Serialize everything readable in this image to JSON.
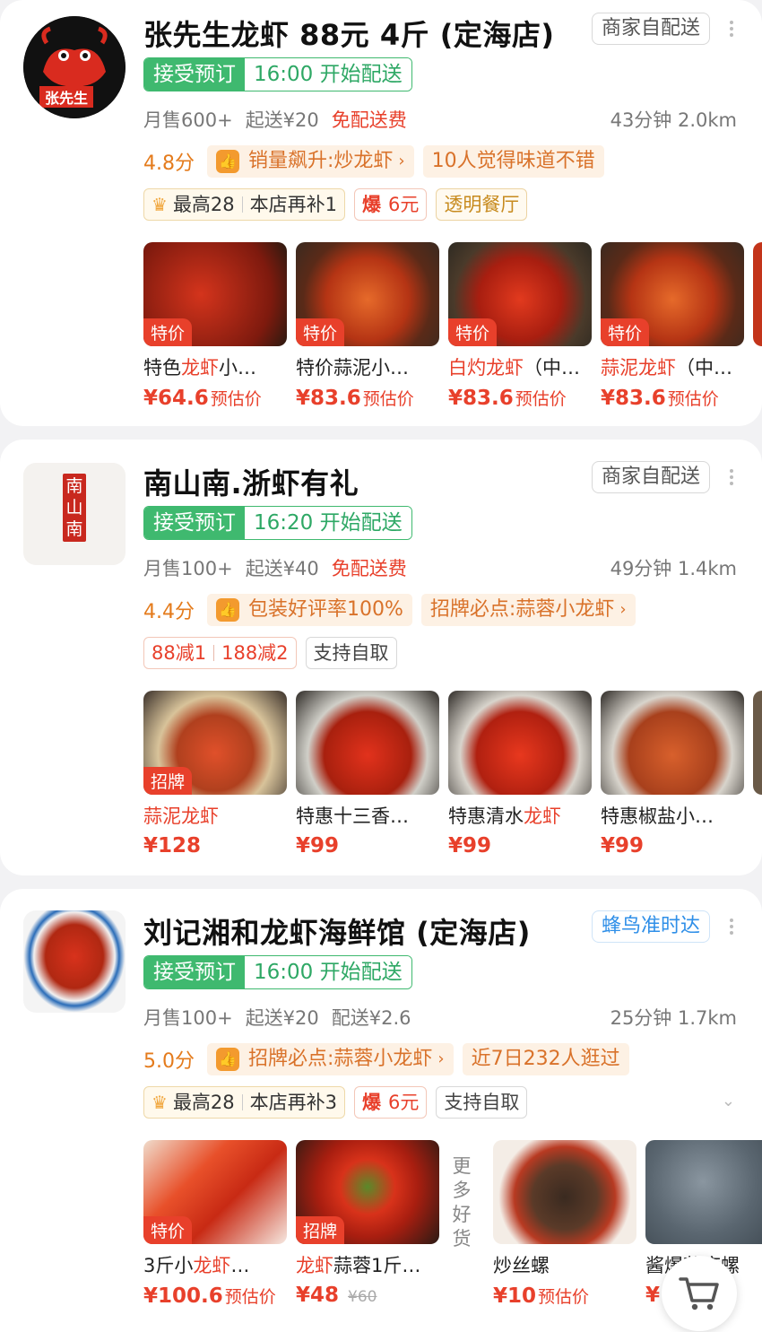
{
  "stores": [
    {
      "name": "张先生龙虾 88元 4斤 (定海店)",
      "delivery_tag": "商家自配送",
      "logo_text": "张先生",
      "booking": {
        "status": "接受预订",
        "start": "16:00 开始配送"
      },
      "monthly_sales": "月售600+",
      "min_order": "起送¥20",
      "delivery_fee": "免配送费",
      "eta": "43分钟 2.0km",
      "score": "4.8分",
      "highlight": "销量飙升:炒龙虾",
      "extra_tag": "10人觉得味道不错",
      "promos": {
        "max": "最高28",
        "subsidy": "本店再补1",
        "hot_label": "爆",
        "hot_value": "6元",
        "tag": "透明餐厅"
      },
      "items": [
        {
          "badge": "特价",
          "name_pre": "特色",
          "name_hl": "龙虾",
          "name_post": "小…",
          "price": "¥64.6",
          "suffix": "预估价"
        },
        {
          "badge": "特价",
          "name_pre": "特价蒜泥小…",
          "name_hl": "",
          "name_post": "",
          "price": "¥83.6",
          "suffix": "预估价"
        },
        {
          "badge": "特价",
          "name_pre": "",
          "name_hl": "白灼龙虾",
          "name_post": "（中…",
          "price": "¥83.6",
          "suffix": "预估价"
        },
        {
          "badge": "特价",
          "name_pre": "",
          "name_hl": "蒜泥龙虾",
          "name_post": "（中…",
          "price": "¥83.6",
          "suffix": "预估价"
        }
      ]
    },
    {
      "name": "南山南.浙虾有礼",
      "delivery_tag": "商家自配送",
      "logo_text": "南山南",
      "booking": {
        "status": "接受预订",
        "start": "16:20 开始配送"
      },
      "monthly_sales": "月售100+",
      "min_order": "起送¥40",
      "delivery_fee": "免配送费",
      "eta": "49分钟 1.4km",
      "score": "4.4分",
      "highlight": "包装好评率100%",
      "extra_tag": "招牌必点:蒜蓉小龙虾",
      "promos": {
        "discount1": "88减1",
        "discount2": "188减2",
        "pickup": "支持自取"
      },
      "items": [
        {
          "badge": "招牌",
          "name_pre": "",
          "name_hl": "蒜泥龙虾",
          "name_post": "",
          "price": "¥128",
          "suffix": ""
        },
        {
          "badge": "",
          "name_pre": "特惠十三香…",
          "name_hl": "",
          "name_post": "",
          "price": "¥99",
          "suffix": ""
        },
        {
          "badge": "",
          "name_pre": "特惠清水",
          "name_hl": "龙虾",
          "name_post": "",
          "price": "¥99",
          "suffix": ""
        },
        {
          "badge": "",
          "name_pre": "特惠椒盐小…",
          "name_hl": "",
          "name_post": "",
          "price": "¥99",
          "suffix": ""
        }
      ]
    },
    {
      "name": "刘记湘和龙虾海鲜馆 (定海店)",
      "delivery_tag": "蜂鸟准时达",
      "booking": {
        "status": "接受预订",
        "start": "16:00 开始配送"
      },
      "monthly_sales": "月售100+",
      "min_order": "起送¥20",
      "delivery_fee": "配送¥2.6",
      "eta": "25分钟 1.7km",
      "score": "5.0分",
      "highlight": "招牌必点:蒜蓉小龙虾",
      "extra_tag": "近7日232人逛过",
      "promos": {
        "max": "最高28",
        "subsidy": "本店再补3",
        "hot_label": "爆",
        "hot_value": "6元",
        "pickup": "支持自取"
      },
      "more_label": "更多好货",
      "items": [
        {
          "badge": "特价",
          "name_pre": "3斤小",
          "name_hl": "龙虾",
          "name_post": "…",
          "price": "¥100.6",
          "suffix": "预估价",
          "old": ""
        },
        {
          "badge": "招牌",
          "name_pre": "",
          "name_hl": "龙虾",
          "name_post": "蒜蓉1斤…",
          "price": "¥48",
          "suffix": "",
          "old": "¥60"
        },
        {
          "badge": "",
          "name_pre": "炒丝螺",
          "name_hl": "",
          "name_post": "",
          "price": "¥10",
          "suffix": "预估价",
          "old": ""
        },
        {
          "badge": "",
          "name_pre": "酱爆花麻螺",
          "name_hl": "",
          "name_post": "",
          "price": "¥",
          "suffix": "",
          "old": ""
        }
      ]
    }
  ],
  "icons": {
    "thumb": "thumbs-up-icon",
    "crown": "crown-icon",
    "cart": "cart-icon",
    "more": "more-vertical-icon"
  },
  "colors": {
    "green": "#3fb96f",
    "red": "#e8402b",
    "orange": "#e47b1c"
  }
}
